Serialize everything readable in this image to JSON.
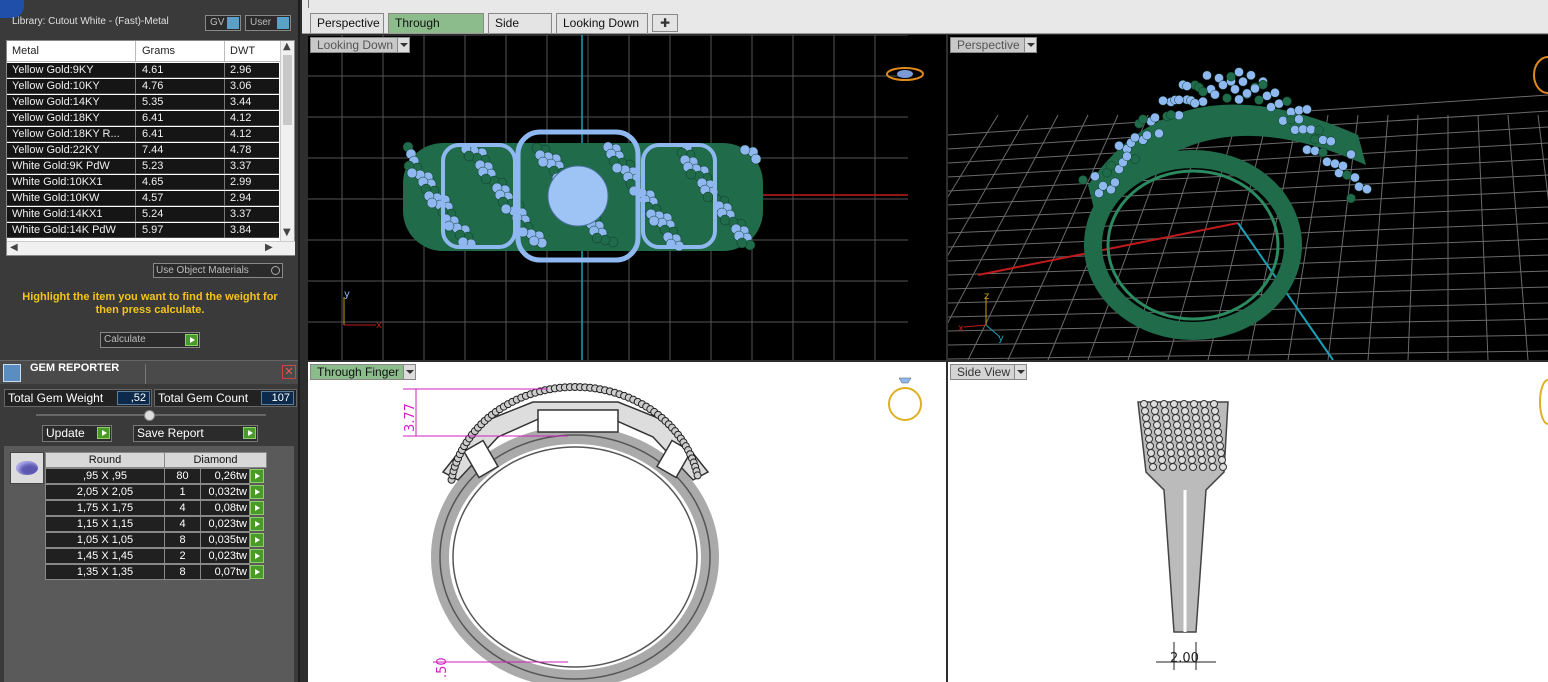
{
  "library": {
    "title": "Library: Cutout White - (Fast)-Metal",
    "gv_label": "GV",
    "user_label": "User",
    "columns": [
      "Metal",
      "Grams",
      "DWT"
    ],
    "rows": [
      {
        "metal": "Yellow Gold:9KY",
        "grams": "4.61",
        "dwt": "2.96"
      },
      {
        "metal": "Yellow Gold:10KY",
        "grams": "4.76",
        "dwt": "3.06"
      },
      {
        "metal": "Yellow Gold:14KY",
        "grams": "5.35",
        "dwt": "3.44"
      },
      {
        "metal": "Yellow Gold:18KY",
        "grams": "6.41",
        "dwt": "4.12"
      },
      {
        "metal": "Yellow Gold:18KY R...",
        "grams": "6.41",
        "dwt": "4.12"
      },
      {
        "metal": "Yellow Gold:22KY",
        "grams": "7.44",
        "dwt": "4.78"
      },
      {
        "metal": "White Gold:9K PdW",
        "grams": "5.23",
        "dwt": "3.37"
      },
      {
        "metal": "White Gold:10KX1",
        "grams": "4.65",
        "dwt": "2.99"
      },
      {
        "metal": "White Gold:10KW",
        "grams": "4.57",
        "dwt": "2.94"
      },
      {
        "metal": "White Gold:14KX1",
        "grams": "5.24",
        "dwt": "3.37"
      },
      {
        "metal": "White Gold:14K PdW",
        "grams": "5.97",
        "dwt": "3.84"
      }
    ],
    "use_object_materials": "Use Object Materials",
    "hint": "Highlight the item you want to find the weight for then press calculate.",
    "calculate": "Calculate"
  },
  "gem_reporter": {
    "title": "GEM REPORTER",
    "close_icon": "close-icon",
    "total_weight_label": "Total Gem Weight",
    "total_weight_value": ",52",
    "total_count_label": "Total Gem Count",
    "total_count_value": "107",
    "update": "Update",
    "save_report": "Save Report",
    "shape_header": "Round",
    "type_header": "Diamond",
    "gems": [
      {
        "size": ",95 X ,95",
        "count": "80",
        "weight": "0,26tw"
      },
      {
        "size": "2,05 X 2,05",
        "count": "1",
        "weight": "0,032tw"
      },
      {
        "size": "1,75 X 1,75",
        "count": "4",
        "weight": "0,08tw"
      },
      {
        "size": "1,15 X 1,15",
        "count": "4",
        "weight": "0,023tw"
      },
      {
        "size": "1,05 X 1,05",
        "count": "8",
        "weight": "0,035tw"
      },
      {
        "size": "1,45 X 1,45",
        "count": "2",
        "weight": "0,023tw"
      },
      {
        "size": "1,35 X 1,35",
        "count": "8",
        "weight": "0,07tw"
      }
    ]
  },
  "tabs": [
    "Perspective",
    "Through Finger",
    "Side View",
    "Looking Down"
  ],
  "active_tab": "Through Finger",
  "viewports": {
    "top_left": "Looking Down",
    "top_right": "Perspective",
    "bottom_left": "Through Finger",
    "bottom_right": "Side View"
  },
  "dimensions": {
    "height": "3.77",
    "bottom": ".50",
    "shank": "2.00"
  },
  "axes": {
    "x": "x",
    "y": "y",
    "z": "z"
  },
  "colors": {
    "metal_green": "#1f6b4a",
    "gem_blue": "#8fb8f0",
    "grid_line": "#555555",
    "dim_magenta": "#d020c0",
    "accent_yellow": "#f5c41a"
  }
}
